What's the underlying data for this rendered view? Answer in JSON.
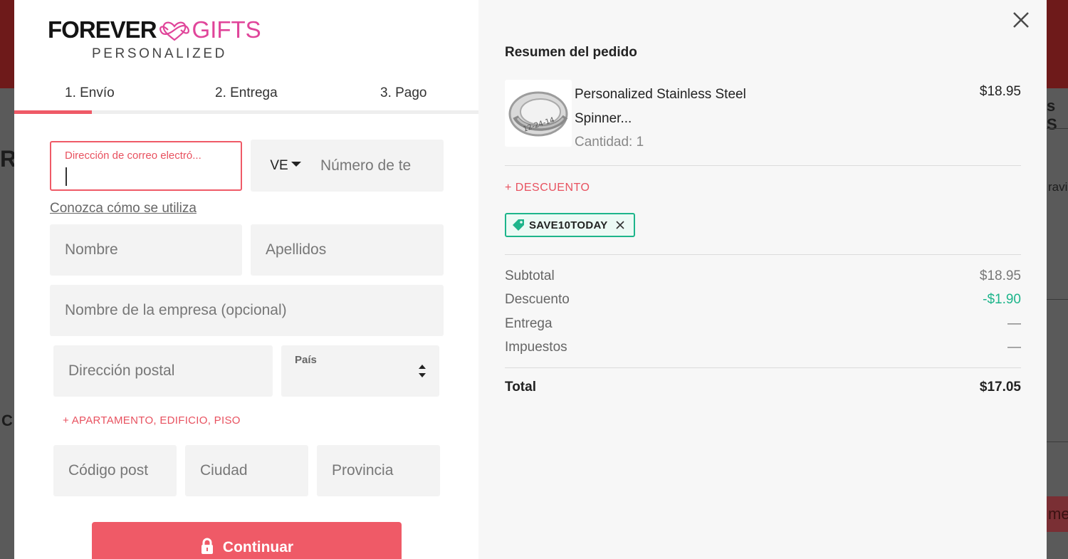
{
  "background": {
    "fragments": [
      "R",
      "s S",
      "C",
      "ravi",
      "me"
    ]
  },
  "brand": {
    "name_left": "FOREVER",
    "name_right": "GIFTS",
    "tagline": "PERSONALIZED",
    "accent_color": "#e0459a"
  },
  "steps": [
    {
      "label": "1. Envío",
      "active": true
    },
    {
      "label": "2. Entrega",
      "active": false
    },
    {
      "label": "3. Pago",
      "active": false
    }
  ],
  "form": {
    "email_label": "Dirección de correo electró...",
    "email_value": "",
    "phone_country": "VE",
    "phone_placeholder": "Número de te",
    "learn_link": "Conozca cómo se utiliza",
    "first_name_placeholder": "Nombre",
    "last_name_placeholder": "Apellidos",
    "company_placeholder": "Nombre de la empresa (opcional)",
    "address_placeholder": "Dirección postal",
    "country_label": "País",
    "add_apartment": "+ APARTAMENTO, EDIFICIO, PISO",
    "postal_placeholder": "Código post",
    "city_placeholder": "Ciudad",
    "province_placeholder": "Provincia",
    "continue_button": "Continuar",
    "accent_color": "#ef5a67"
  },
  "summary": {
    "title": "Resumen del pedido",
    "product": {
      "name": "Personalized Stainless Steel Spinner...",
      "quantity_label": "Cantidad: 1",
      "price": "$18.95",
      "engraving_text": "12-24-14"
    },
    "discount_link": "+ DESCUENTO",
    "coupon_code": "SAVE10TODAY",
    "rows": [
      {
        "label": "Subtotal",
        "value": "$18.95"
      },
      {
        "label": "Descuento",
        "value": "-$1.90"
      },
      {
        "label": "Entrega",
        "value": "—"
      },
      {
        "label": "Impuestos",
        "value": "—"
      }
    ],
    "total_label": "Total",
    "total_value": "$17.05",
    "discount_color": "#1db58b"
  }
}
